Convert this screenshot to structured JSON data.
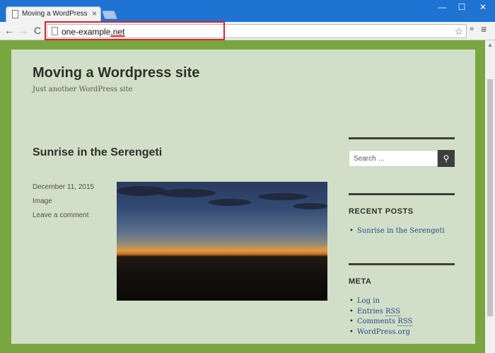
{
  "browser": {
    "tab_title": "Moving a WordPress site -",
    "tab_close": "×",
    "win_min": "—",
    "win_max": "☐",
    "win_close": "✕",
    "nav_back": "←",
    "nav_forward": "→",
    "nav_reload": "C",
    "url_prefix": "one-example",
    "url_tld": ".net",
    "star": "☆",
    "extensions": "»",
    "menu": "≡",
    "accent_color": "#1e73d3",
    "highlight_color": "#d9232d"
  },
  "site": {
    "title": "Moving a Wordpress site",
    "description": "Just another WordPress site",
    "frame_color": "#7aa642",
    "panel_color": "#d2dfc8"
  },
  "post": {
    "title": "Sunrise in the Serengeti",
    "date": "December 11, 2015",
    "format": "Image",
    "comment_link": "Leave a comment",
    "image_icon": "sunrise-photo"
  },
  "sidebar": {
    "search_placeholder": "Search …",
    "search_icon": "⚲",
    "recent_posts_title": "RECENT POSTS",
    "recent_posts": [
      "Sunrise in the Serengeti"
    ],
    "meta_title": "META",
    "meta_links": {
      "login": "Log in",
      "entries_prefix": "Entries ",
      "entries_rss": "RSS",
      "comments_prefix": "Comments ",
      "comments_rss": "RSS",
      "wordpress": "WordPress.org"
    },
    "bullet": "•"
  },
  "scrollbar": {
    "up_arrow": "▲"
  }
}
